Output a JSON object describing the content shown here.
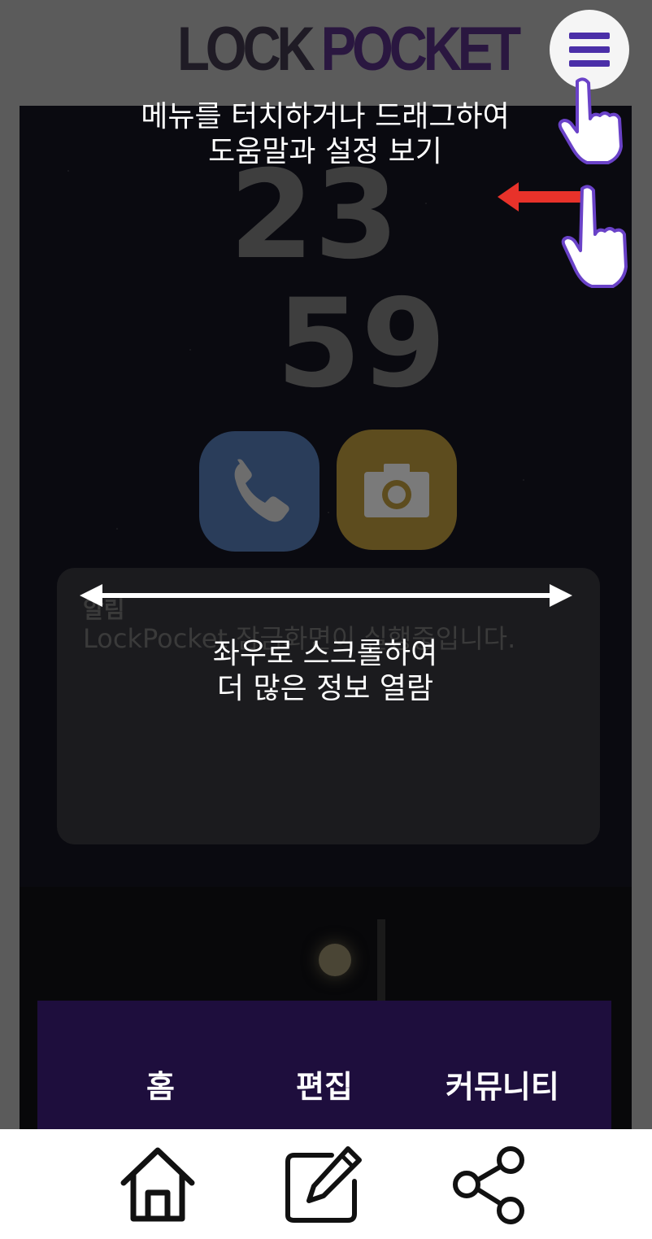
{
  "header": {
    "logo_part1": "LOCK",
    "logo_part2": "POCKET"
  },
  "lockscreen": {
    "clock_hour": "23",
    "clock_minute": "59",
    "notification": {
      "title": "알림",
      "body": "LockPocket 잠금화면이 실행중입니다."
    }
  },
  "tabs": [
    {
      "label": "홈"
    },
    {
      "label": "편집"
    },
    {
      "label": "커뮤니티"
    }
  ],
  "hints": {
    "menu_line1": "메뉴를 터치하거나 드래그하여",
    "menu_line2": "도움말과 설정 보기",
    "scroll_line1": "좌우로 스크롤하여",
    "scroll_line2": "더 많은 정보 열람"
  },
  "bottom_nav": [
    {
      "icon": "home-icon"
    },
    {
      "icon": "edit-icon"
    },
    {
      "icon": "share-icon"
    }
  ],
  "colors": {
    "accent": "#4b2fa8",
    "tabbar": "#1e0e3d",
    "arrow": "#e8322a"
  }
}
